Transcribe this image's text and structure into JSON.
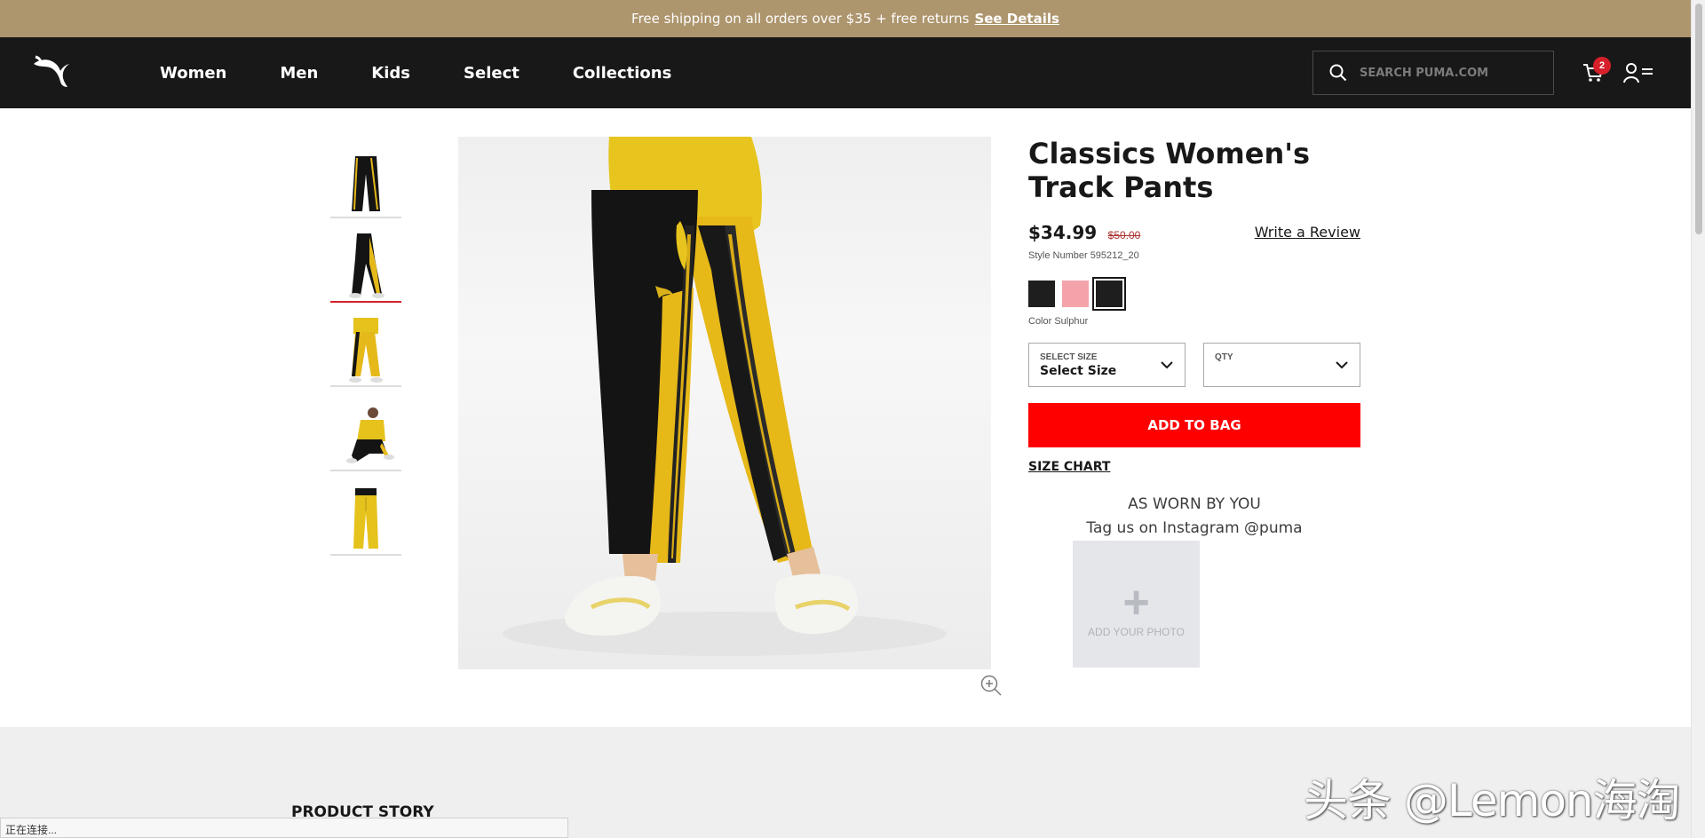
{
  "promo": {
    "text": "Free shipping on all orders over $35 + free returns",
    "link": "See Details"
  },
  "nav": {
    "items": [
      "Women",
      "Men",
      "Kids",
      "Select",
      "Collections"
    ],
    "search_placeholder": "SEARCH PUMA.COM",
    "cart_count": "2"
  },
  "product": {
    "title": "Classics Women's Track Pants",
    "price": "$34.99",
    "old_price": "$50.00",
    "review_link": "Write a Review",
    "style_number": "Style Number 595212_20",
    "swatch_colors": [
      "#1e1e1e",
      "#f4a3ab",
      "#1e1e1e"
    ],
    "color_label": "Color Sulphur",
    "size_select": {
      "label": "SELECT SIZE",
      "value": "Select Size"
    },
    "qty_select": {
      "label": "QTY",
      "value": ""
    },
    "add_to_bag": "ADD TO BAG",
    "size_chart": "SIZE CHART",
    "worn_title": "AS WORN BY YOU",
    "worn_sub": "Tag us on Instagram @puma",
    "add_photo": "ADD YOUR PHOTO"
  },
  "lower": {
    "story_heading": "PRODUCT STORY",
    "watermark": "头条 @Lemon海淘"
  },
  "status": "正在连接..."
}
